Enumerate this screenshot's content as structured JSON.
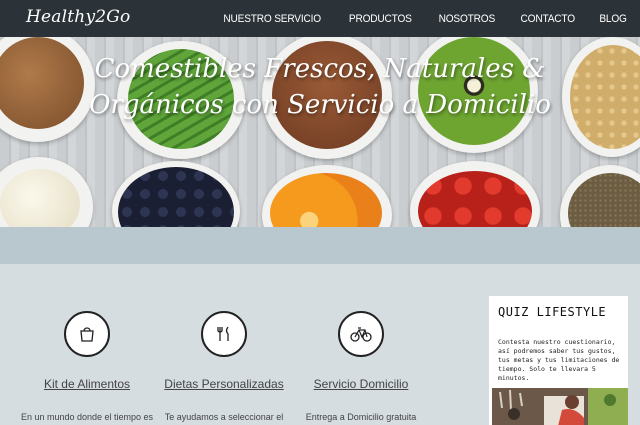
{
  "nav": {
    "brand": "Healthy2Go",
    "items": [
      "NUESTRO SERVICIO",
      "PRODUCTOS",
      "NOSOTROS",
      "CONTACTO",
      "BLOG"
    ]
  },
  "hero": {
    "title_line1": "Comestibles Frescos, Naturales &",
    "title_line2": "Orgánicos con Servicio a Domicilio"
  },
  "features": [
    {
      "icon": "shopping-bag-icon",
      "glyph": "🛍",
      "title": "Kit de Alimentos",
      "text": "En un mundo donde el tiempo es"
    },
    {
      "icon": "fork-knife-icon",
      "glyph": "🍴",
      "title": "Dietas Personalizadas",
      "text": "Te ayudamos a seleccionar el"
    },
    {
      "icon": "bicycle-icon",
      "glyph": "🚲",
      "title": "Servicio Domicilio",
      "text": "Entrega a Domicilio gratuita"
    }
  ],
  "quiz": {
    "title": "QUIZ LIFESTYLE",
    "text": "Contesta nuestro cuestionario, así podremos saber tus gustos, tus metas y tus limitaciones de tiempo. Solo te llevara 5 minutos."
  }
}
